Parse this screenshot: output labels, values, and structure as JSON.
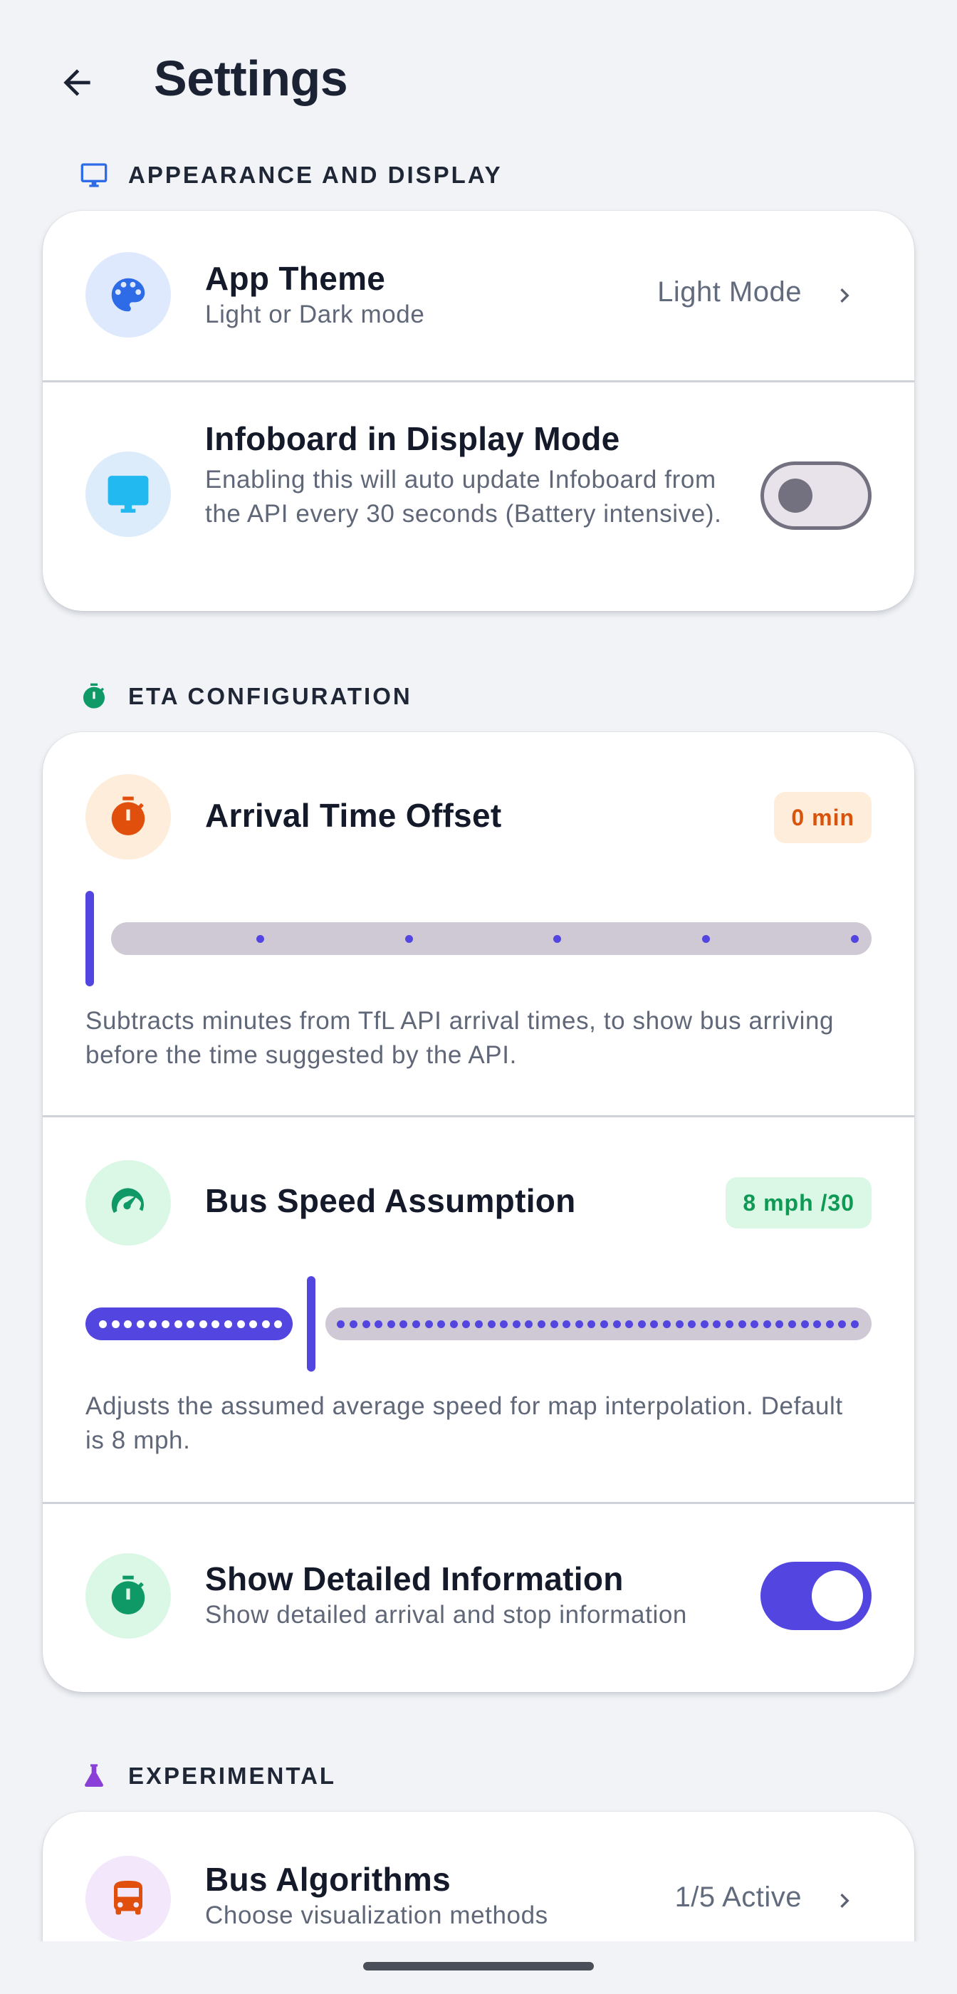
{
  "header": {
    "title": "Settings",
    "back_icon": "arrow-back-icon"
  },
  "colors": {
    "accent": "#5345E0",
    "background": "#F1F3F6",
    "appearance_icon": "#2E6BE6",
    "eta_icon": "#0E9966",
    "experimental_icon": "#8B3FD9",
    "offset_icon": "#E0500C",
    "bus_icon": "#E0500C"
  },
  "sections": {
    "appearance": {
      "label": "APPEARANCE AND DISPLAY",
      "icon": "monitor-icon"
    },
    "eta": {
      "label": "ETA CONFIGURATION",
      "icon": "timer-icon"
    },
    "experimental": {
      "label": "EXPERIMENTAL",
      "icon": "flask-icon"
    }
  },
  "app_theme": {
    "title": "App Theme",
    "subtitle": "Light or Dark mode",
    "value": "Light Mode",
    "icon": "palette-icon"
  },
  "infoboard": {
    "title": "Infoboard in Display Mode",
    "subtitle": "Enabling this will auto update Infoboard from the API every 30 seconds (Battery intensive).",
    "enabled": false,
    "icon": "monitor-icon"
  },
  "arrival_offset": {
    "title": "Arrival Time Offset",
    "badge": "0 min",
    "value": 0,
    "min": 0,
    "max": 5,
    "steps": 5,
    "description": "Subtracts minutes from TfL API arrival times, to show bus arriving before the time suggested by the API.",
    "icon": "timer-icon"
  },
  "bus_speed": {
    "title": "Bus Speed Assumption",
    "badge": "8 mph /30",
    "value": 8,
    "min": 0,
    "max": 30,
    "description": "Adjusts the assumed average speed for map interpolation. Default is 8 mph.",
    "icon": "speedometer-icon"
  },
  "detailed_info": {
    "title": "Show Detailed Information",
    "subtitle": "Show detailed arrival and stop information",
    "enabled": true,
    "icon": "timer-icon"
  },
  "bus_algorithms": {
    "title": "Bus Algorithms",
    "subtitle": "Choose visualization methods",
    "value": "1/5 Active",
    "icon": "bus-icon"
  }
}
